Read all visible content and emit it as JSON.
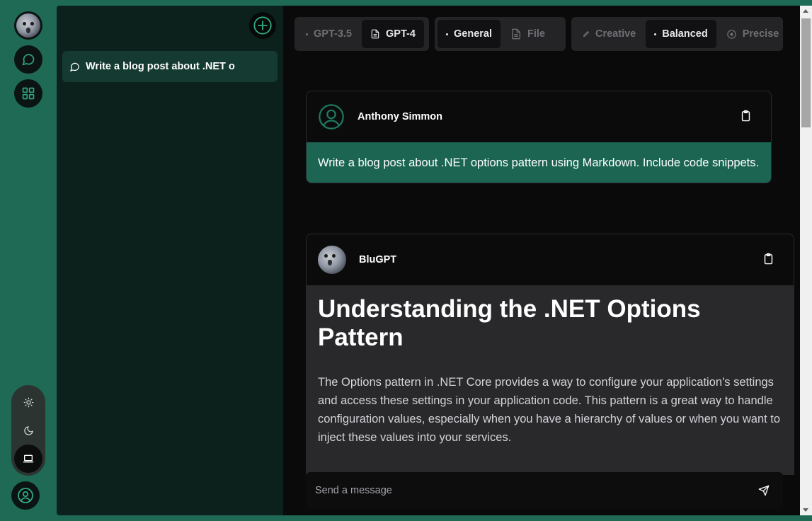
{
  "sidebar": {
    "conversations": [
      {
        "title": "Write a blog post about .NET o"
      }
    ]
  },
  "models": [
    {
      "label": "GPT-3.5",
      "active": false
    },
    {
      "label": "GPT-4",
      "active": true
    }
  ],
  "modes": [
    {
      "label": "General",
      "active": true
    },
    {
      "label": "File",
      "active": false
    }
  ],
  "styles": [
    {
      "label": "Creative",
      "active": false
    },
    {
      "label": "Balanced",
      "active": true
    },
    {
      "label": "Precise",
      "active": false
    }
  ],
  "messages": {
    "user": {
      "name": "Anthony Simmon",
      "text": "Write a blog post about .NET options pattern using Markdown. Include code snippets."
    },
    "bot": {
      "name": "BluGPT",
      "heading": "Understanding the .NET Options Pattern",
      "paragraph": "The Options pattern in .NET Core provides a way to configure your application's settings and access these settings in your application code. This pattern is a great way to handle configuration values, especially when you have a hierarchy of values or when you want to inject these values into your services."
    }
  },
  "composer": {
    "placeholder": "Send a message"
  },
  "colors": {
    "accent": "#1e6a55",
    "user_bubble": "#1b6552",
    "sidebar_bg": "#0d211c",
    "main_bg": "#0a0a0b"
  }
}
